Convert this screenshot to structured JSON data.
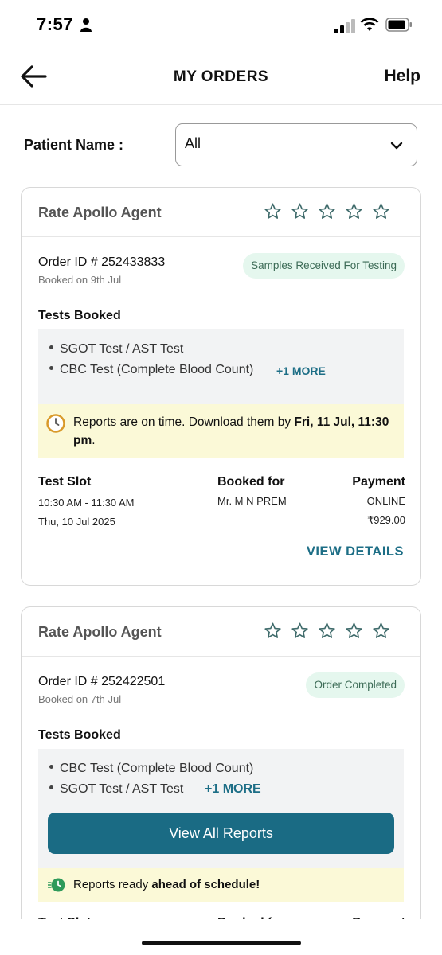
{
  "status_bar": {
    "time": "7:57"
  },
  "header": {
    "title": "MY ORDERS",
    "help_label": "Help"
  },
  "filter": {
    "patient_label": "Patient Name :",
    "selected": "All"
  },
  "orders": [
    {
      "rate_label": "Rate Apollo Agent",
      "rating": 0,
      "order_id": "Order ID # 252433833",
      "booked_on": "Booked on 9th Jul",
      "status": "Samples Received For Testing",
      "tests_heading": "Tests Booked",
      "tests": [
        "SGOT Test / AST Test",
        "CBC Test (Complete Blood Count)"
      ],
      "more_label": "+1 MORE",
      "notice": {
        "prefix": "Reports are on time. Download them by ",
        "bold": "Fri, 11 Jul, 11:30 pm",
        "suffix": "."
      },
      "slot": {
        "heading": "Test Slot",
        "time": "10:30 AM - 11:30 AM",
        "date": "Thu, 10 Jul 2025"
      },
      "booked_for": {
        "heading": "Booked for",
        "name": "Mr. M N PREM"
      },
      "payment": {
        "heading": "Payment",
        "mode": "ONLINE",
        "amount": "₹929.00"
      },
      "view_details_label": "VIEW DETAILS"
    },
    {
      "rate_label": "Rate Apollo Agent",
      "rating": 0,
      "order_id": "Order ID # 252422501",
      "booked_on": "Booked on 7th Jul",
      "status": "Order Completed",
      "tests_heading": "Tests Booked",
      "tests": [
        "CBC Test (Complete Blood Count)",
        "SGOT Test / AST Test"
      ],
      "more_label": "+1 MORE",
      "view_reports_label": "View All Reports",
      "notice": {
        "prefix": "Reports ready ",
        "bold": "ahead of schedule!",
        "suffix": ""
      },
      "slot": {
        "heading": "Test Slot"
      },
      "booked_for": {
        "heading": "Booked for"
      },
      "payment": {
        "heading": "Payment"
      }
    }
  ],
  "colors": {
    "accent": "#1a6b84",
    "badge_bg": "#e5f7ee",
    "notice_bg": "#fbf9d7",
    "star": "#3f6b6b"
  }
}
